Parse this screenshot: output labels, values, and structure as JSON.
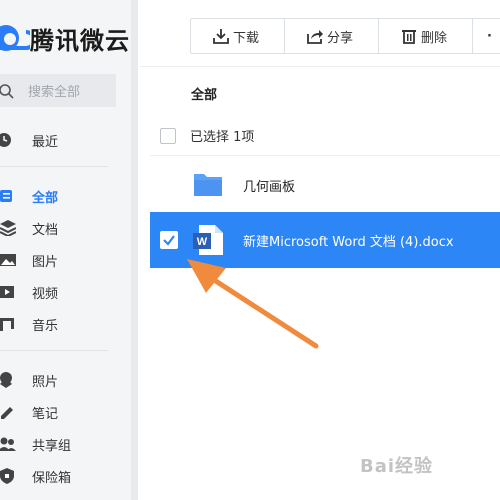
{
  "app": {
    "name": "腾讯微云"
  },
  "search": {
    "placeholder": "搜索全部"
  },
  "sidebar": {
    "items": [
      {
        "key": "recent",
        "label": "最近",
        "icon": "clock-icon"
      },
      {
        "key": "all",
        "label": "全部",
        "icon": "list-icon",
        "active": true
      },
      {
        "key": "docs",
        "label": "文档",
        "icon": "layers-icon"
      },
      {
        "key": "images",
        "label": "图片",
        "icon": "image-icon"
      },
      {
        "key": "videos",
        "label": "视频",
        "icon": "play-icon"
      },
      {
        "key": "music",
        "label": "音乐",
        "icon": "music-icon"
      },
      {
        "key": "photos",
        "label": "照片",
        "icon": "photo-icon"
      },
      {
        "key": "notes",
        "label": "笔记",
        "icon": "pen-icon"
      },
      {
        "key": "share",
        "label": "共享组",
        "icon": "users-icon"
      },
      {
        "key": "vault",
        "label": "保险箱",
        "icon": "shield-icon"
      }
    ]
  },
  "toolbar": {
    "download": "下载",
    "share": "分享",
    "delete": "删除",
    "more": "·"
  },
  "main": {
    "breadcrumb": "全部",
    "selection": "已选择 1项",
    "files": [
      {
        "name": "几何画板",
        "type": "folder",
        "selected": false
      },
      {
        "name": "新建Microsoft Word 文档 (4).docx",
        "type": "word",
        "selected": true
      }
    ]
  },
  "watermark": "Bai经验",
  "colors": {
    "accent": "#2a7cf7",
    "selected_row": "#2d86f5",
    "arrow": "#f08a3c"
  }
}
